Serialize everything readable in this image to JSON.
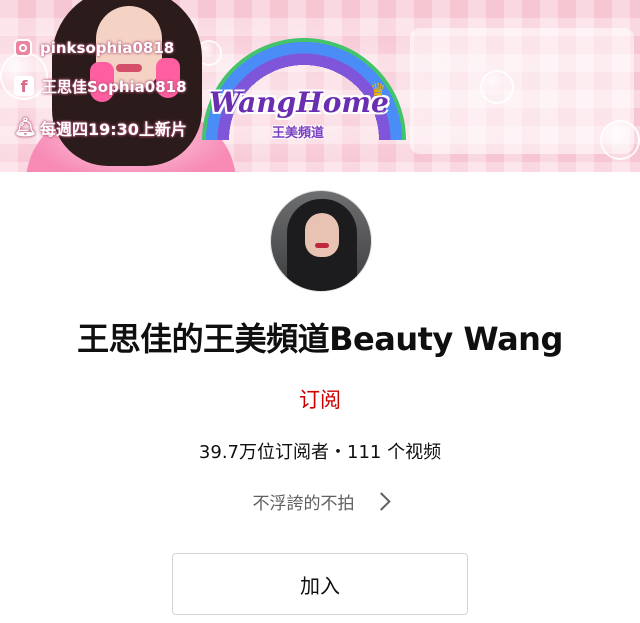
{
  "banner": {
    "logo_word": "WangHome",
    "logo_sub": "王美頻道",
    "instagram_handle": "pinksophia0818",
    "facebook_page": "王思佳Sophia0818",
    "schedule": "每週四19:30上新片",
    "icons": [
      "instagram-icon",
      "facebook-icon",
      "bell-icon"
    ]
  },
  "channel": {
    "name": "王思佳的王美頻道Beauty Wang",
    "subscribe_label": "订阅",
    "stats": "39.7万位订阅者・111 个视频",
    "tagline": "不浮誇的不拍",
    "join_label": "加入"
  },
  "colors": {
    "subscribe": "#cc0000",
    "banner_pink": "#f7c6d3"
  }
}
